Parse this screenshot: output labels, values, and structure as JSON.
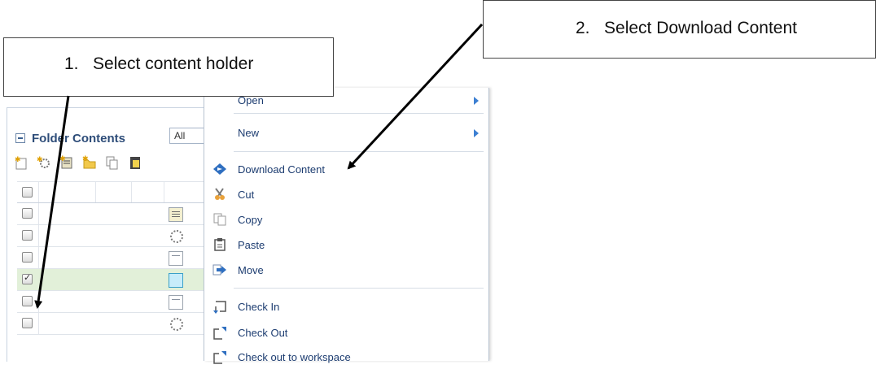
{
  "annotations": {
    "step1": "1.   Select content holder",
    "step2": "2.   Select Download Content"
  },
  "panel": {
    "title": "Folder Contents",
    "filter_value": "All",
    "toolbar_icons": [
      "new-item-icon",
      "new-gear-icon",
      "new-collection-icon",
      "new-folder-icon",
      "copy-icon",
      "paste-icon"
    ],
    "rows": [
      {
        "checked": false,
        "icon": "note-icon"
      },
      {
        "checked": false,
        "icon": "gear-icon"
      },
      {
        "checked": false,
        "icon": "document-icon"
      },
      {
        "checked": true,
        "icon": "content-holder-icon",
        "selected": true
      },
      {
        "checked": false,
        "icon": "document-icon"
      },
      {
        "checked": false,
        "icon": "gear-icon"
      }
    ]
  },
  "context_menu": {
    "items": [
      {
        "label": "Open",
        "icon": "",
        "submenu": true
      },
      {
        "label": "New",
        "icon": "",
        "submenu": true
      },
      {
        "label": "Download Content",
        "icon": "download-icon",
        "submenu": false
      },
      {
        "label": "Cut",
        "icon": "scissors-icon",
        "submenu": false
      },
      {
        "label": "Copy",
        "icon": "copy-icon",
        "submenu": false
      },
      {
        "label": "Paste",
        "icon": "paste-icon",
        "submenu": false
      },
      {
        "label": "Move",
        "icon": "move-icon",
        "submenu": false
      },
      {
        "label": "Check In",
        "icon": "check-in-icon",
        "submenu": false
      },
      {
        "label": "Check Out",
        "icon": "check-out-icon",
        "submenu": false
      },
      {
        "label": "Check out to workspace",
        "icon": "check-out-workspace-icon",
        "submenu": false
      }
    ]
  },
  "colors": {
    "selected_row": "#e2f0d9",
    "menu_text": "#1c3c70",
    "submenu_arrow": "#3c7fd2"
  }
}
